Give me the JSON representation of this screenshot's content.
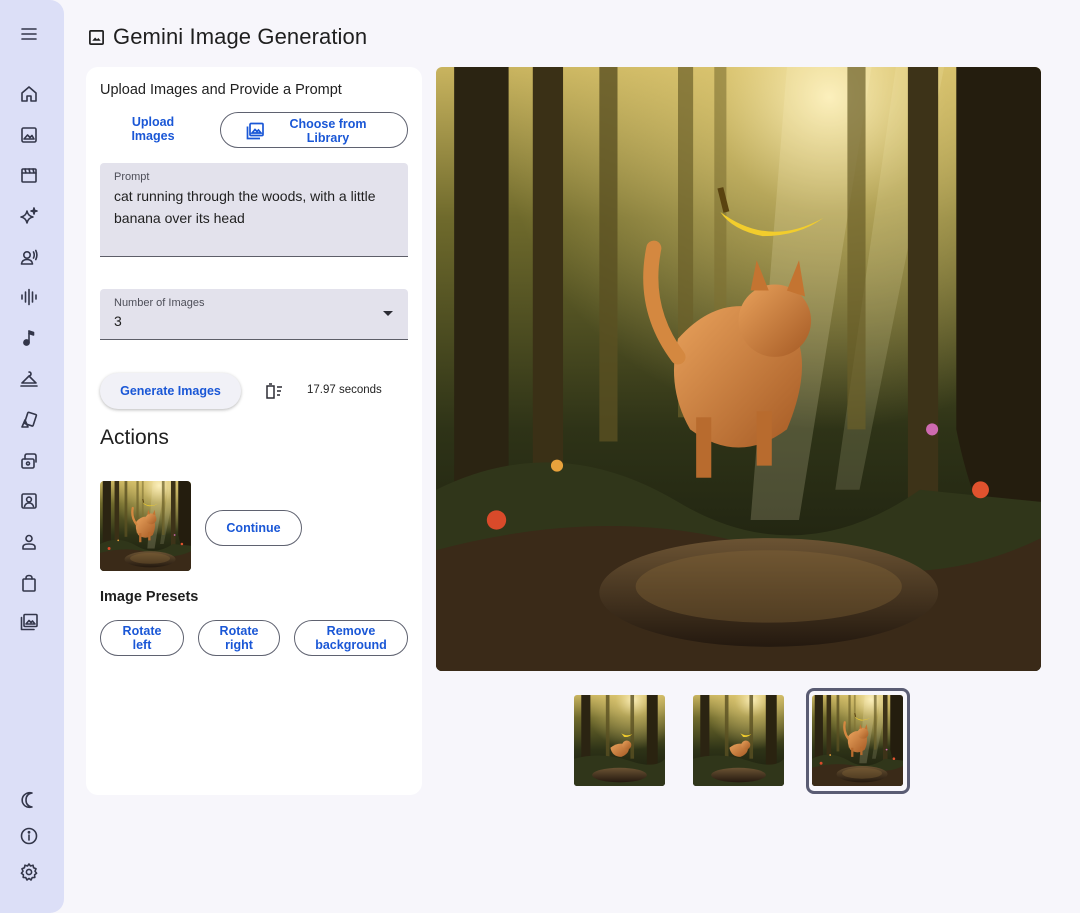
{
  "app": {
    "title": "Gemini Image Generation"
  },
  "sidebar": {
    "items": [
      {
        "icon": "menu-icon"
      },
      {
        "icon": "home-icon"
      },
      {
        "icon": "image-icon"
      },
      {
        "icon": "movie-icon"
      },
      {
        "icon": "sparkle-icon"
      },
      {
        "icon": "voice-icon"
      },
      {
        "icon": "waveform-icon"
      },
      {
        "icon": "music-note-icon"
      },
      {
        "icon": "try-on-icon"
      },
      {
        "icon": "shapes-icon"
      },
      {
        "icon": "layers-icon"
      },
      {
        "icon": "portrait-icon"
      },
      {
        "icon": "person-icon"
      },
      {
        "icon": "shopping-bag-icon"
      },
      {
        "icon": "photo-library-icon"
      }
    ],
    "footer": [
      {
        "icon": "dark-mode-icon"
      },
      {
        "icon": "info-icon"
      },
      {
        "icon": "settings-icon"
      }
    ]
  },
  "upload": {
    "heading": "Upload Images and Provide a Prompt",
    "upload_label": "Upload Images",
    "library_label": "Choose from Library"
  },
  "prompt": {
    "label": "Prompt",
    "value": "cat running through the woods, with a little banana over its head"
  },
  "num_images": {
    "label": "Number of Images",
    "value": "3"
  },
  "generate": {
    "label": "Generate Images",
    "timer_icon": "timer-icon",
    "elapsed": "17.97 seconds"
  },
  "actions": {
    "heading": "Actions",
    "continue_label": "Continue"
  },
  "presets": {
    "heading": "Image Presets",
    "items": [
      {
        "label": "Rotate left"
      },
      {
        "label": "Rotate right"
      },
      {
        "label": "Remove background"
      }
    ]
  },
  "results": {
    "count": 3,
    "selected_index": 2
  },
  "colors": {
    "accent": "#1a57d6",
    "sidebar_bg": "#dcdff7",
    "page_bg": "#f7f6fb",
    "field_bg": "#e3e2ec",
    "selected_border": "#5a5c73"
  }
}
